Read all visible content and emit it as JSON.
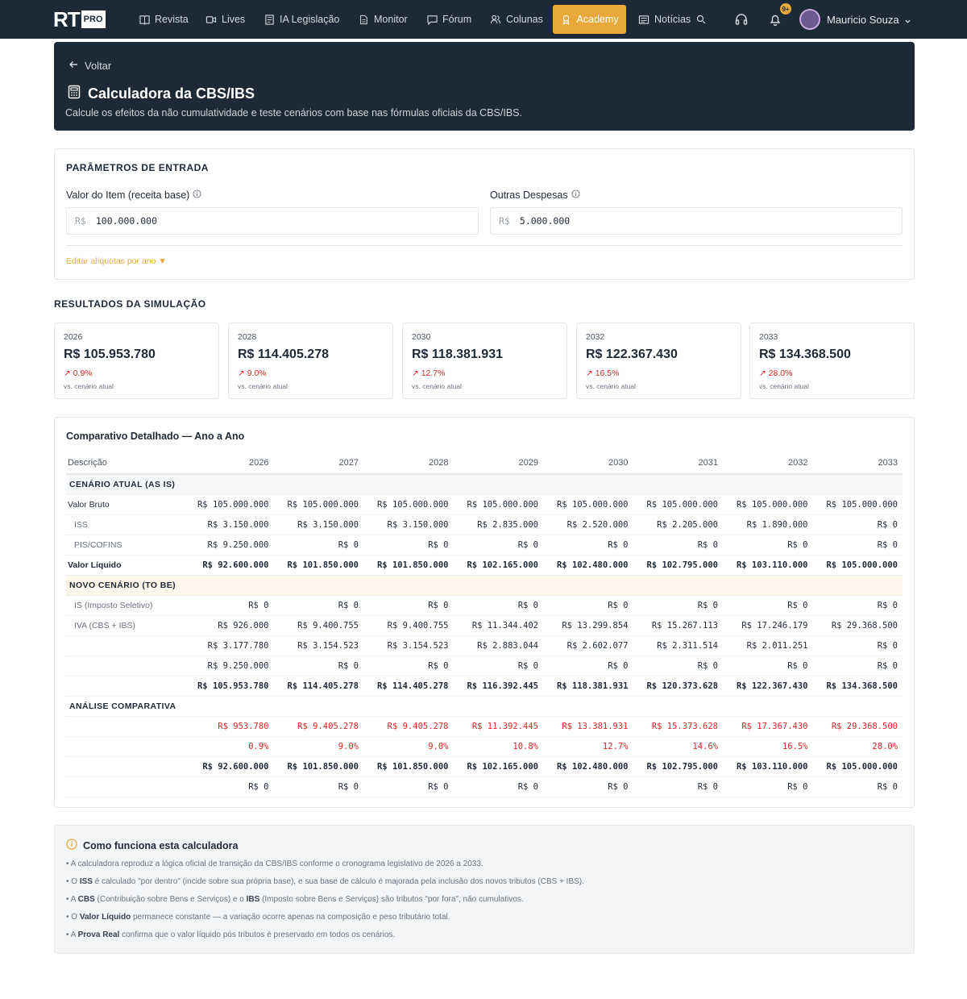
{
  "brand": {
    "logo_text": "RT",
    "pro": "PRO"
  },
  "nav": {
    "items": [
      {
        "label": "Revista",
        "icon": "book-icon"
      },
      {
        "label": "Lives",
        "icon": "video-icon"
      },
      {
        "label": "IA Legislação",
        "icon": "document-icon"
      },
      {
        "label": "Monitor",
        "icon": "file-icon"
      },
      {
        "label": "Fórum",
        "icon": "chat-icon"
      },
      {
        "label": "Colunas",
        "icon": "users-icon"
      },
      {
        "label": "Academy",
        "icon": "award-icon",
        "active": true
      },
      {
        "label": "Notícias",
        "icon": "news-icon"
      }
    ],
    "notifications_badge": "9+",
    "user_name": "Mauricio Souza"
  },
  "hero": {
    "back_label": "Voltar",
    "title": "Calculadora da CBS/IBS",
    "subtitle": "Calcule os efeitos da não cumulatividade e teste cenários com base nas fórmulas oficiais da CBS/IBS."
  },
  "params": {
    "title": "PARÂMETROS DE ENTRADA",
    "item_label": "Valor do Item (receita base)",
    "item_currency": "R$",
    "item_value": "100.000.000",
    "other_label": "Outras Despesas",
    "other_currency": "R$",
    "other_value": "5.000.000",
    "edit_link": "Editar alíquotas por ano ▼"
  },
  "results": {
    "title": "RESULTADOS DA SIMULAÇÃO",
    "cards": [
      {
        "year": "2026",
        "value": "R$ 105.953.780",
        "pct": "↗ 0.9%",
        "vs": "vs. cenário atual"
      },
      {
        "year": "2028",
        "value": "R$ 114.405.278",
        "pct": "↗ 9.0%",
        "vs": "vs. cenário atual"
      },
      {
        "year": "2030",
        "value": "R$ 118.381.931",
        "pct": "↗ 12.7%",
        "vs": "vs. cenário atual"
      },
      {
        "year": "2032",
        "value": "R$ 122.367.430",
        "pct": "↗ 16.5%",
        "vs": "vs. cenário atual"
      },
      {
        "year": "2033",
        "value": "R$ 134.368.500",
        "pct": "↗ 28.0%",
        "vs": "vs. cenário atual"
      }
    ]
  },
  "comparison": {
    "title": "Comparativo Detalhado — Ano a Ano",
    "headers": [
      "Descrição",
      "2026",
      "2027",
      "2028",
      "2029",
      "2030",
      "2031",
      "2032",
      "2033"
    ],
    "rows": [
      {
        "kind": "section",
        "cls": "",
        "label": "CENÁRIO ATUAL (AS IS)"
      },
      {
        "kind": "row",
        "label": "Valor Bruto",
        "indent": false,
        "bold": false,
        "red": false,
        "cells": [
          "R$ 105.000.000",
          "R$ 105.000.000",
          "R$ 105.000.000",
          "R$ 105.000.000",
          "R$ 105.000.000",
          "R$ 105.000.000",
          "R$ 105.000.000",
          "R$ 105.000.000"
        ]
      },
      {
        "kind": "row",
        "label": "ISS",
        "indent": true,
        "bold": false,
        "red": false,
        "cells": [
          "R$ 3.150.000",
          "R$ 3.150.000",
          "R$ 3.150.000",
          "R$ 2.835.000",
          "R$ 2.520.000",
          "R$ 2.205.000",
          "R$ 1.890.000",
          "R$ 0"
        ]
      },
      {
        "kind": "row",
        "label": "PIS/COFINS",
        "indent": true,
        "bold": false,
        "red": false,
        "cells": [
          "R$ 9.250.000",
          "R$ 0",
          "R$ 0",
          "R$ 0",
          "R$ 0",
          "R$ 0",
          "R$ 0",
          "R$ 0"
        ]
      },
      {
        "kind": "row",
        "label": "Valor Líquido",
        "indent": false,
        "bold": true,
        "red": false,
        "cells": [
          "R$ 92.600.000",
          "R$ 101.850.000",
          "R$ 101.850.000",
          "R$ 102.165.000",
          "R$ 102.480.000",
          "R$ 102.795.000",
          "R$ 103.110.000",
          "R$ 105.000.000"
        ]
      },
      {
        "kind": "section",
        "cls": "new",
        "label": "NOVO CENÁRIO (TO BE)"
      },
      {
        "kind": "row",
        "label": "IS (Imposto Seletivo)",
        "indent": true,
        "bold": false,
        "red": false,
        "cells": [
          "R$ 0",
          "R$ 0",
          "R$ 0",
          "R$ 0",
          "R$ 0",
          "R$ 0",
          "R$ 0",
          "R$ 0"
        ]
      },
      {
        "kind": "row",
        "label": "IVA (CBS + IBS)",
        "indent": true,
        "bold": false,
        "red": false,
        "cells": [
          "R$ 926.000",
          "R$ 9.400.755",
          "R$ 9.400.755",
          "R$ 11.344.402",
          "R$ 13.299.854",
          "R$ 15.267.113",
          "R$ 17.246.179",
          "R$ 29.368.500"
        ]
      },
      {
        "kind": "row",
        "label": "",
        "indent": false,
        "bold": false,
        "red": false,
        "cells": [
          "R$ 3.177.780",
          "R$ 3.154.523",
          "R$ 3.154.523",
          "R$ 2.883.044",
          "R$ 2.602.077",
          "R$ 2.311.514",
          "R$ 2.011.251",
          "R$ 0"
        ]
      },
      {
        "kind": "row",
        "label": "",
        "indent": false,
        "bold": false,
        "red": false,
        "cells": [
          "R$ 9.250.000",
          "R$ 0",
          "R$ 0",
          "R$ 0",
          "R$ 0",
          "R$ 0",
          "R$ 0",
          "R$ 0"
        ]
      },
      {
        "kind": "row",
        "label": "",
        "indent": false,
        "bold": true,
        "red": false,
        "cells": [
          "R$ 105.953.780",
          "R$ 114.405.278",
          "R$ 114.405.278",
          "R$ 116.392.445",
          "R$ 118.381.931",
          "R$ 120.373.628",
          "R$ 122.367.430",
          "R$ 134.368.500"
        ]
      },
      {
        "kind": "section",
        "cls": "ana",
        "label": "ANÁLISE COMPARATIVA"
      },
      {
        "kind": "row",
        "label": "",
        "indent": false,
        "bold": false,
        "red": true,
        "cells": [
          "R$ 953.780",
          "R$ 9.405.278",
          "R$ 9.405.278",
          "R$ 11.392.445",
          "R$ 13.381.931",
          "R$ 15.373.628",
          "R$ 17.367.430",
          "R$ 29.368.500"
        ]
      },
      {
        "kind": "row",
        "label": "",
        "indent": false,
        "bold": false,
        "red": true,
        "cells": [
          "0.9%",
          "9.0%",
          "9.0%",
          "10.8%",
          "12.7%",
          "14.6%",
          "16.5%",
          "28.0%"
        ]
      },
      {
        "kind": "row",
        "label": "",
        "indent": false,
        "bold": true,
        "red": false,
        "cells": [
          "R$ 92.600.000",
          "R$ 101.850.000",
          "R$ 101.850.000",
          "R$ 102.165.000",
          "R$ 102.480.000",
          "R$ 102.795.000",
          "R$ 103.110.000",
          "R$ 105.000.000"
        ]
      },
      {
        "kind": "row",
        "label": "",
        "indent": false,
        "bold": false,
        "red": false,
        "cells": [
          "R$ 0",
          "R$ 0",
          "R$ 0",
          "R$ 0",
          "R$ 0",
          "R$ 0",
          "R$ 0",
          "R$ 0"
        ]
      }
    ]
  },
  "info": {
    "title": "Como funciona esta calculadora",
    "lines": [
      [
        {
          "t": "• A calculadora reproduz a lógica oficial de transição da CBS/IBS conforme o cronograma legislativo de 2026 a 2033."
        }
      ],
      [
        {
          "t": "• O "
        },
        {
          "t": "ISS",
          "b": true
        },
        {
          "t": " é calculado \"por dentro\" (incide sobre sua própria base), e sua base de cálculo é majorada pela inclusão dos novos tributos (CBS + IBS)."
        }
      ],
      [
        {
          "t": "• A "
        },
        {
          "t": "CBS",
          "b": true
        },
        {
          "t": " (Contribuição sobre Bens e Serviços) e o "
        },
        {
          "t": "IBS",
          "b": true
        },
        {
          "t": " (Imposto sobre Bens e Serviços) são tributos \"por fora\", não cumulativos."
        }
      ],
      [
        {
          "t": "• O "
        },
        {
          "t": "Valor Líquido",
          "b": true
        },
        {
          "t": " permanece constante — a variação ocorre apenas na composição e peso tributário total."
        }
      ],
      [
        {
          "t": "• A "
        },
        {
          "t": "Prova Real",
          "b": true
        },
        {
          "t": " confirma que o valor líquido pós tributos é preservado em todos os cenários."
        }
      ]
    ]
  },
  "colors": {
    "navy": "#1b2a36",
    "accent": "#e9a93a",
    "negative": "#dc2626"
  }
}
